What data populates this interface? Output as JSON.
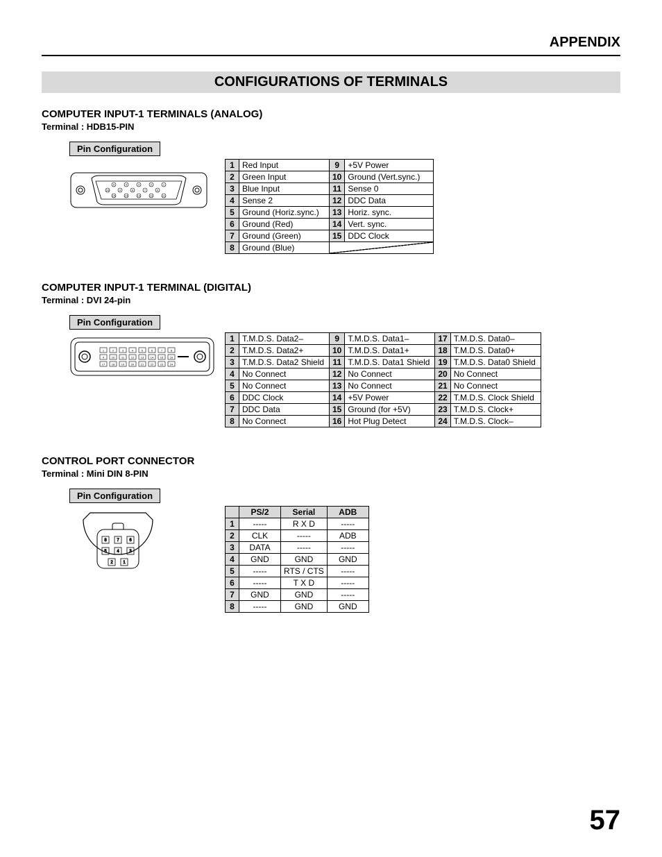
{
  "header": "APPENDIX",
  "banner": "CONFIGURATIONS OF TERMINALS",
  "page_number": "57",
  "pinconf_label": "Pin Configuration",
  "sections": [
    {
      "title": "COMPUTER INPUT-1 TERMINALS (ANALOG)",
      "sub": "Terminal : HDB15-PIN",
      "table": {
        "rows": [
          [
            "1",
            "Red Input",
            "9",
            "+5V Power"
          ],
          [
            "2",
            "Green Input",
            "10",
            "Ground (Vert.sync.)"
          ],
          [
            "3",
            "Blue Input",
            "11",
            "Sense 0"
          ],
          [
            "4",
            "Sense 2",
            "12",
            "DDC Data"
          ],
          [
            "5",
            "Ground (Horiz.sync.)",
            "13",
            "Horiz. sync."
          ],
          [
            "6",
            "Ground (Red)",
            "14",
            "Vert. sync."
          ],
          [
            "7",
            "Ground (Green)",
            "15",
            "DDC Clock"
          ],
          [
            "8",
            "Ground (Blue)",
            "",
            ""
          ]
        ]
      }
    },
    {
      "title": "COMPUTER INPUT-1 TERMINAL (DIGITAL)",
      "sub": "Terminal : DVI 24-pin",
      "table": {
        "rows": [
          [
            "1",
            "T.M.D.S. Data2–",
            "9",
            "T.M.D.S. Data1–",
            "17",
            "T.M.D.S. Data0–"
          ],
          [
            "2",
            "T.M.D.S. Data2+",
            "10",
            "T.M.D.S. Data1+",
            "18",
            "T.M.D.S. Data0+"
          ],
          [
            "3",
            "T.M.D.S. Data2 Shield",
            "11",
            "T.M.D.S. Data1 Shield",
            "19",
            "T.M.D.S. Data0 Shield"
          ],
          [
            "4",
            "No Connect",
            "12",
            "No Connect",
            "20",
            "No Connect"
          ],
          [
            "5",
            "No Connect",
            "13",
            "No Connect",
            "21",
            "No Connect"
          ],
          [
            "6",
            "DDC Clock",
            "14",
            "+5V Power",
            "22",
            "T.M.D.S. Clock Shield"
          ],
          [
            "7",
            "DDC Data",
            "15",
            "Ground (for +5V)",
            "23",
            "T.M.D.S. Clock+"
          ],
          [
            "8",
            "No Connect",
            "16",
            "Hot Plug Detect",
            "24",
            "T.M.D.S. Clock–"
          ]
        ]
      }
    },
    {
      "title": "CONTROL PORT CONNECTOR",
      "sub": "Terminal : Mini DIN 8-PIN",
      "table": {
        "headers": [
          "",
          "PS/2",
          "Serial",
          "ADB"
        ],
        "rows": [
          [
            "1",
            "-----",
            "R X D",
            "-----"
          ],
          [
            "2",
            "CLK",
            "-----",
            "ADB"
          ],
          [
            "3",
            "DATA",
            "-----",
            "-----"
          ],
          [
            "4",
            "GND",
            "GND",
            "GND"
          ],
          [
            "5",
            "-----",
            "RTS / CTS",
            "-----"
          ],
          [
            "6",
            "-----",
            "T X D",
            "-----"
          ],
          [
            "7",
            "GND",
            "GND",
            "-----"
          ],
          [
            "8",
            "-----",
            "GND",
            "GND"
          ]
        ]
      }
    }
  ]
}
